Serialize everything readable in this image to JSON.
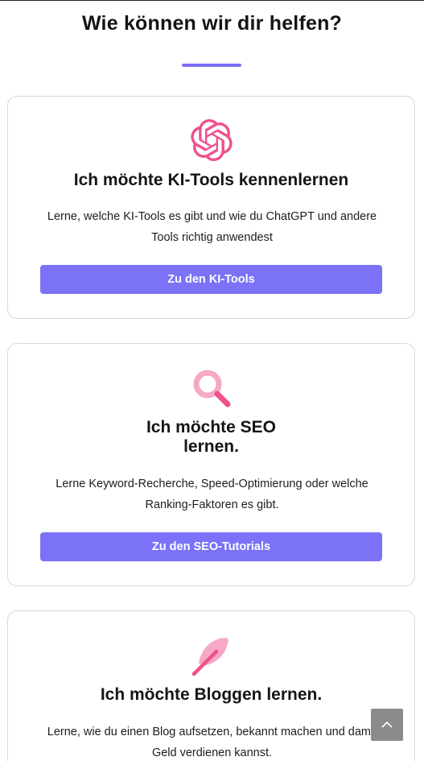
{
  "page": {
    "heading": "Wie können wir dir helfen?",
    "accent_color": "#7b6ef6",
    "icon_color": "#f0508c"
  },
  "cards": [
    {
      "icon": "openai-logo-icon",
      "title": "Ich möchte KI-Tools kennenlernen",
      "text_lines": [
        "Lerne, welche KI-Tools es gibt und wie du ChatGPT und andere",
        "Tools richtig anwendest"
      ],
      "button_label": "Zu den KI-Tools"
    },
    {
      "icon": "magnifier-icon",
      "title_lines": [
        "Ich möchte SEO",
        "lernen."
      ],
      "text_lines": [
        "Lerne Keyword-Recherche, Speed-Optimierung oder welche",
        "Ranking-Faktoren es gibt."
      ],
      "button_label": "Zu den SEO-Tutorials"
    },
    {
      "icon": "feather-icon",
      "title": "Ich möchte Bloggen lernen.",
      "text_lines": [
        "Lerne, wie du einen Blog aufsetzen, bekannt machen und damit",
        "Geld verdienen kannst."
      ]
    }
  ],
  "scroll_top": {
    "icon": "chevron-up-icon"
  }
}
